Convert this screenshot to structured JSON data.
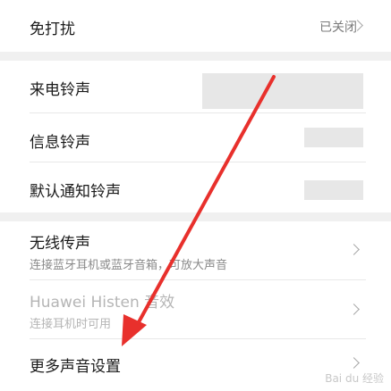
{
  "settings": {
    "dnd": {
      "title": "免打扰",
      "value": "已关闭"
    },
    "ringtones": [
      {
        "title": "来电铃声"
      },
      {
        "title": "信息铃声"
      },
      {
        "title": "默认通知铃声"
      }
    ],
    "wireless_sound": {
      "title": "无线传声",
      "subtitle": "连接蓝牙耳机或蓝牙音箱，可放大声音"
    },
    "histen": {
      "title": "Huawei Histen 音效",
      "subtitle": "连接耳机时可用"
    },
    "more_sound": {
      "title": "更多声音设置"
    }
  },
  "watermark": "Bai du 经验",
  "colors": {
    "arrow": "#e8302c",
    "background": "#f0f0f0",
    "card": "#ffffff"
  }
}
